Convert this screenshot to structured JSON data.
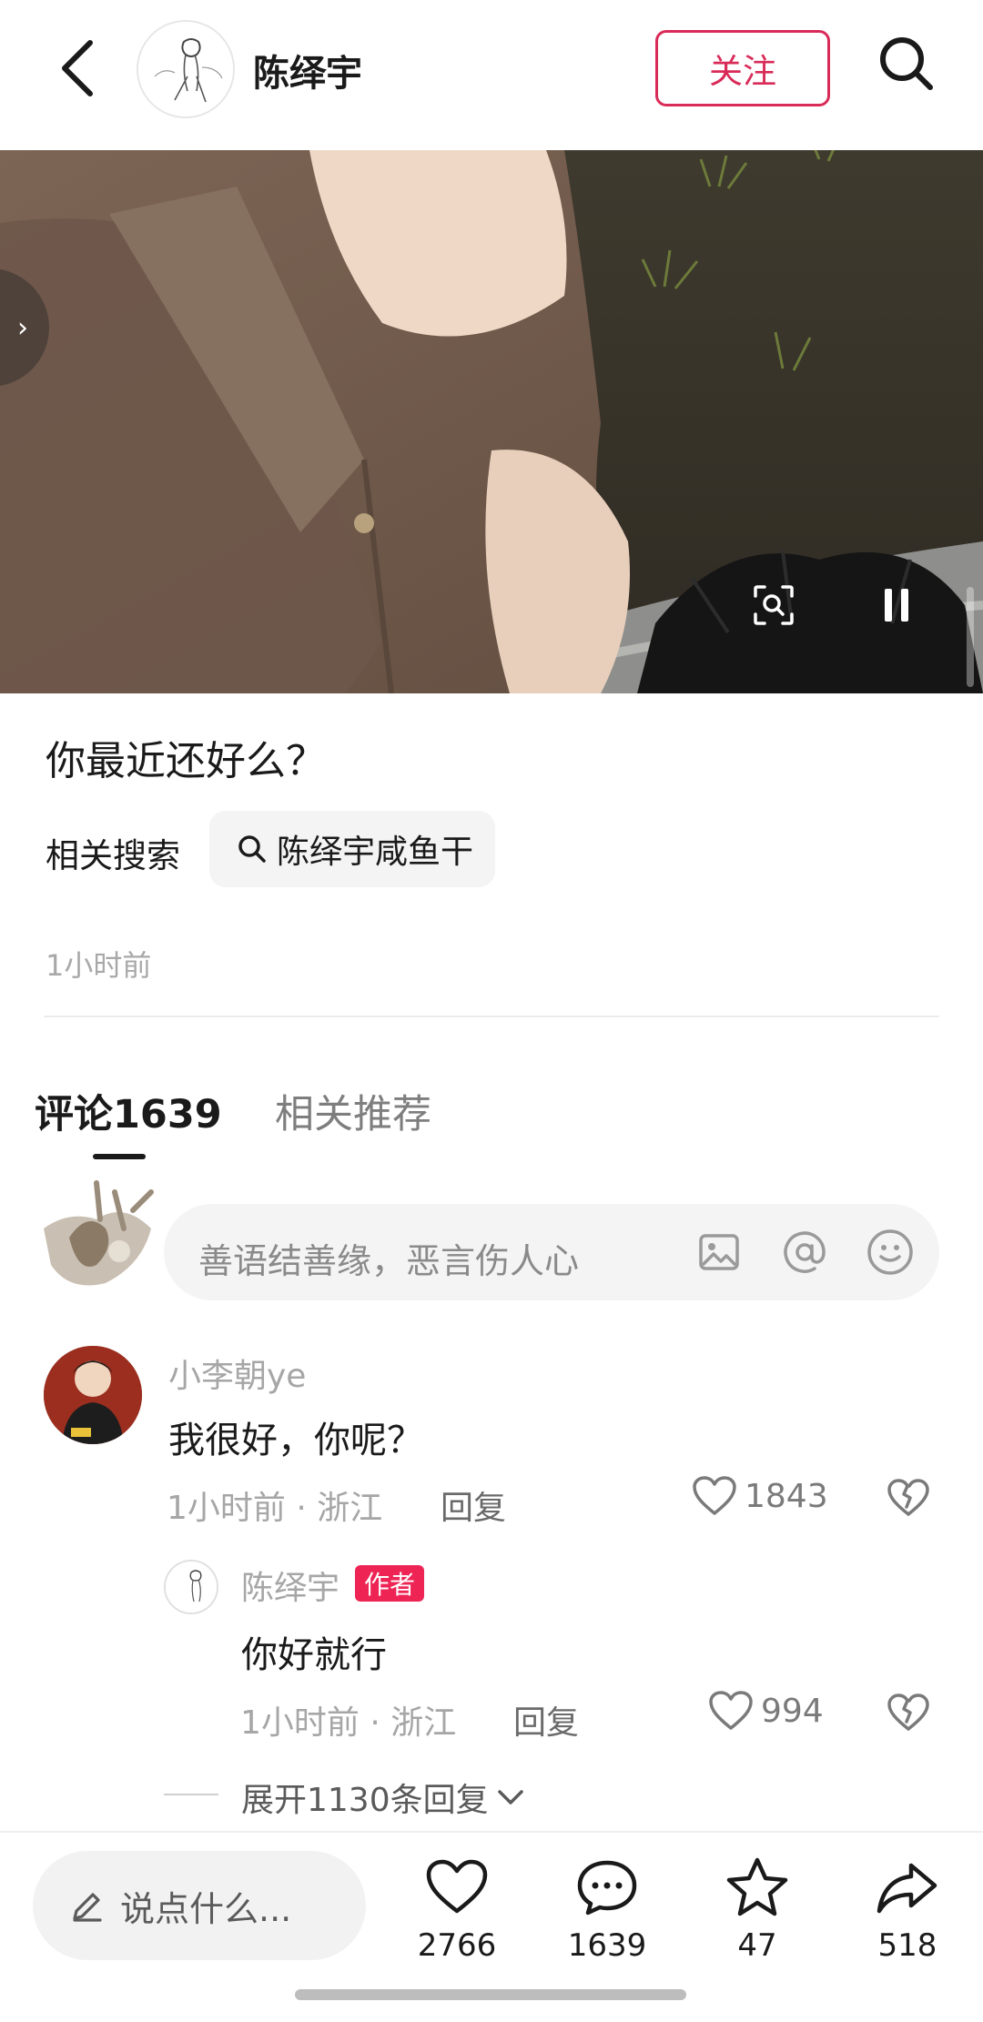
{
  "header": {
    "author_name": "陈绎宇",
    "follow_label": "关注",
    "icons": [
      "chevron-left-icon",
      "search-icon"
    ]
  },
  "media": {
    "icons": [
      "chevron-right-icon",
      "scan-icon",
      "pause-icon"
    ]
  },
  "post": {
    "title": "你最近还好么？",
    "related_label": "相关搜索",
    "related_query": "陈绎宇咸鱼干",
    "time_ago": "1小时前"
  },
  "tabs": {
    "comments": "评论1639",
    "related": "相关推荐"
  },
  "comment_input": {
    "placeholder": "善语结善缘，恶言伤人心",
    "icons": [
      "image-icon",
      "at-icon",
      "emoji-icon"
    ]
  },
  "comments": [
    {
      "user": "小李朝ye",
      "text": "我很好，你呢？",
      "meta": "1小时前 · 浙江",
      "reply_label": "回复",
      "likes": "1843",
      "replies": [
        {
          "user": "陈绎宇",
          "badge": "作者",
          "text": "你好就行",
          "meta": "1小时前 · 浙江",
          "reply_label": "回复",
          "likes": "994"
        }
      ],
      "expand_label": "展开1130条回复"
    }
  ],
  "bottom_bar": {
    "say_placeholder": "说点什么...",
    "likes": "2766",
    "comments": "1639",
    "favorites": "47",
    "shares": "518"
  },
  "colors": {
    "accent": "#d92b58",
    "badge": "#ee2455",
    "muted": "#a6a6a6"
  }
}
